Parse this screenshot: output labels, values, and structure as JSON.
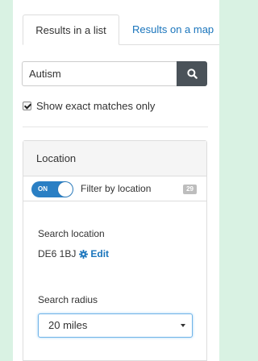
{
  "tabs": {
    "list_label": "Results in a list",
    "map_label": "Results on a map"
  },
  "search": {
    "value": "Autism",
    "button_icon": "search-icon"
  },
  "exact_matches": {
    "label": "Show exact matches only",
    "checked": true
  },
  "location": {
    "header": "Location",
    "toggle_label": "ON",
    "filter_label": "Filter by location",
    "count": "29",
    "search_location_label": "Search location",
    "postcode": "DE6 1BJ",
    "edit_label": "Edit",
    "edit_icon": "gear-icon",
    "search_radius_label": "Search radius",
    "radius_value": "20 miles"
  },
  "colors": {
    "background": "#d9f2e3",
    "accent": "#1a75bc",
    "toggle": "#2a7fc4",
    "search_button": "#4a5259"
  }
}
